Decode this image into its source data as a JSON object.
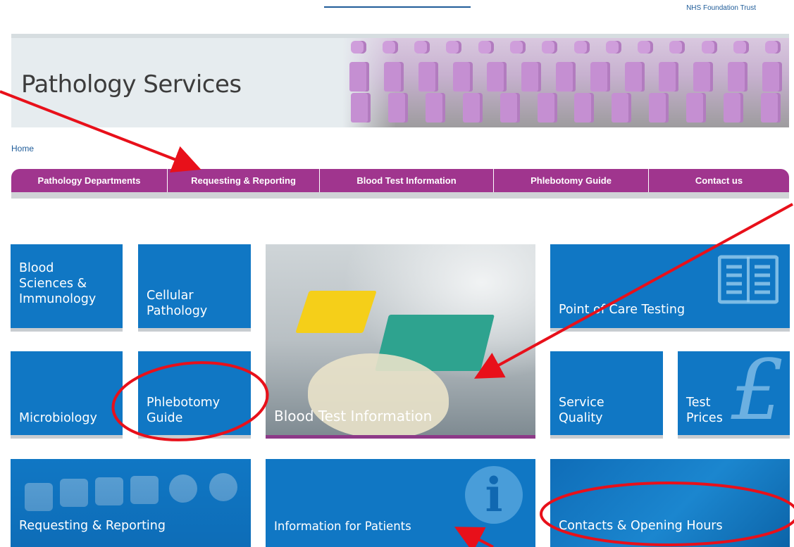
{
  "header": {
    "trust_text": "NHS Foundation Trust",
    "site_title": "Pathology Services"
  },
  "breadcrumb": {
    "home": "Home"
  },
  "nav": {
    "items": [
      {
        "label": "Pathology Departments"
      },
      {
        "label": "Requesting & Reporting"
      },
      {
        "label": "Blood Test Information"
      },
      {
        "label": "Phlebotomy Guide"
      },
      {
        "label": "Contact us"
      }
    ]
  },
  "tiles": {
    "blood_sciences": "Blood\nSciences &\nImmunology",
    "cellular_pathology": "Cellular\nPathology",
    "blood_test_info": "Blood Test Information",
    "point_of_care": "Point of Care Testing",
    "microbiology": "Microbiology",
    "phlebotomy_guide": "Phlebotomy\nGuide",
    "service_quality": "Service\nQuality",
    "test_prices": "Test\nPrices",
    "requesting_reporting": "Requesting & Reporting",
    "info_patients": "Information for Patients",
    "contacts_hours": "Contacts & Opening Hours"
  },
  "colors": {
    "tile_blue": "#1077c4",
    "nav_purple": "#a0358e",
    "annotation_red": "#e8101a",
    "link_blue": "#1f5c99"
  }
}
